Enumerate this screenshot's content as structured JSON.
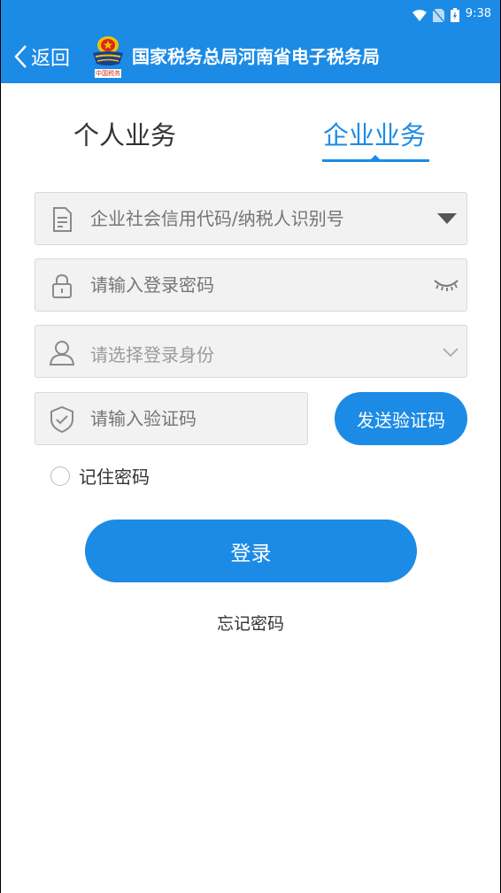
{
  "status_bar": {
    "time": "9:38"
  },
  "app_bar": {
    "back_label": "返回",
    "title": "国家税务总局河南省电子税务局",
    "emblem_text": "中国税务"
  },
  "tabs": [
    {
      "label": "个人业务",
      "active": false
    },
    {
      "label": "企业业务",
      "active": true
    }
  ],
  "form": {
    "taxpayer_id_placeholder": "企业社会信用代码/纳税人识别号",
    "password_placeholder": "请输入登录密码",
    "identity_placeholder": "请选择登录身份",
    "code_placeholder": "请输入验证码",
    "send_code_label": "发送验证码",
    "remember_label": "记住密码",
    "remember_checked": false,
    "login_label": "登录",
    "forgot_label": "忘记密码"
  },
  "colors": {
    "accent": "#1c8be6",
    "field_bg": "#f2f2f2",
    "placeholder": "#9b9b9b"
  }
}
